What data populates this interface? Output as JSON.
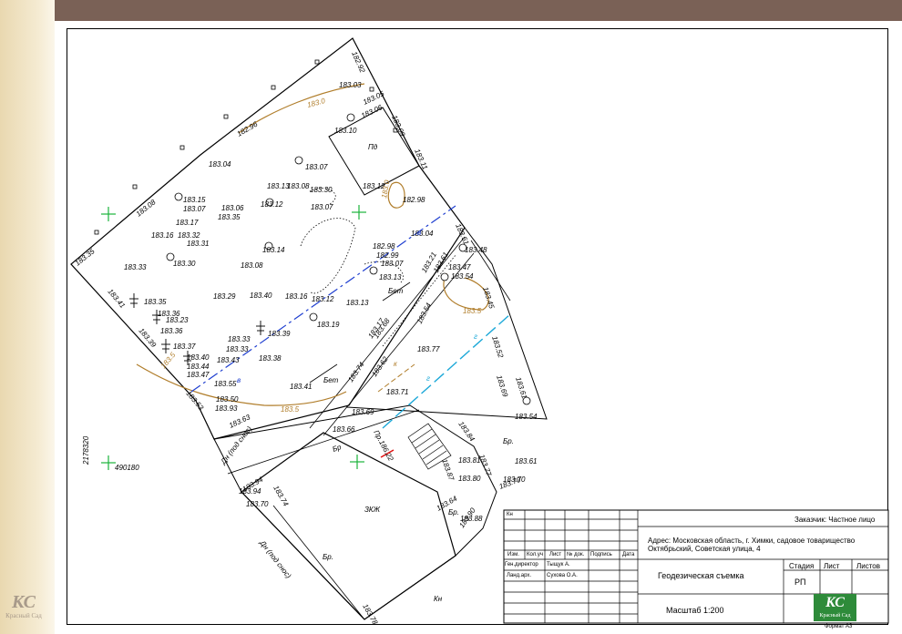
{
  "logo": {
    "mark": "КС",
    "text": "Красный Сад"
  },
  "plan": {
    "spot_heights": [
      "183.03",
      "183.04",
      "183.07",
      "183.15",
      "183.07",
      "183.06",
      "183.35",
      "183.17",
      "183.16",
      "183.32",
      "183.31",
      "183.33",
      "183.30",
      "183.12",
      "183.30",
      "183.07",
      "183.14",
      "183.08",
      "183.13",
      "183.08",
      "183.29",
      "183.40",
      "183.16",
      "183.12",
      "183.13",
      "183.19",
      "183.35",
      "183.36",
      "183.23",
      "183.36",
      "183.37",
      "183.39",
      "183.33",
      "183.33",
      "183.40",
      "183.43",
      "183.38",
      "183.44",
      "183.47",
      "183.55",
      "183.41",
      "183.50",
      "183.93",
      "183.10",
      "183.12",
      "182.98",
      "183.04",
      "182.98",
      "182.99",
      "183.07",
      "183.13",
      "183.48",
      "183.47",
      "183.54",
      "183.77",
      "183.71",
      "183.66",
      "183.69",
      "183.61",
      "183.70",
      "183.81",
      "183.80",
      "183.94",
      "183.70",
      "183.88"
    ],
    "boundary_heights": [
      "182.92",
      "183.05",
      "183.06",
      "183.09",
      "183.11",
      "182.96",
      "183.08",
      "183.35",
      "183.41",
      "183.39",
      "183.53",
      "183.63",
      "183.51",
      "183.45",
      "183.52",
      "183.69",
      "183.54",
      "183.61",
      "183.70",
      "183.74",
      "183.68",
      "183.62",
      "183.54",
      "183.17",
      "183.21",
      "183.61",
      "183.84",
      "183.77",
      "183.87",
      "183.64",
      "183.90",
      "183.94",
      "183.74",
      "183.78"
    ],
    "contours": [
      "183.0",
      "183.0",
      "183.5",
      "183.5",
      "183.5"
    ],
    "labels": {
      "pd": "Пд",
      "bet1": "Бет",
      "bet2": "Бет",
      "br1": "Бр",
      "br2": "Бр.",
      "br3": "Бр.",
      "br4": "Бр.",
      "kn1": "Кн",
      "kn2": "Кн",
      "building": "ЗКЖ",
      "dn1": "Дн (под снос)",
      "dn2": "Дн (под снос)",
      "steps": "Пр.186.22",
      "coord_x": "2178320",
      "coord_y": "490180",
      "v": "в",
      "k": "к",
      "g": "г"
    }
  },
  "title_block": {
    "customer": "Заказчик: Частное лицо",
    "address_line1": "Адрес: Московская область, г. Химки, садовое товарищество",
    "address_line2": "Октябрьский, Советская улица, 4",
    "kn": "Кн",
    "headers": [
      "Изм.",
      "Кол.уч",
      "Лист",
      "№ док.",
      "Подпись",
      "Дата"
    ],
    "row1_role": "Ген.директор",
    "row1_name": "Тыщук А.",
    "row2_role": "Ланд.арх.",
    "row2_name": "Сухова О.А.",
    "work": "Геодезическая съемка",
    "stage_label": "Стадия",
    "sheet_label": "Лист",
    "sheets_label": "Листов",
    "stage_value": "РП",
    "scale": "Масштаб 1:200",
    "format": "Формат А3"
  },
  "colors": {
    "topbar": "#7a6156",
    "contour": "#b07d2a",
    "line_v": "#1f3fd0",
    "line_g": "#1ca8d8",
    "logo_green": "#2e8b3a"
  }
}
